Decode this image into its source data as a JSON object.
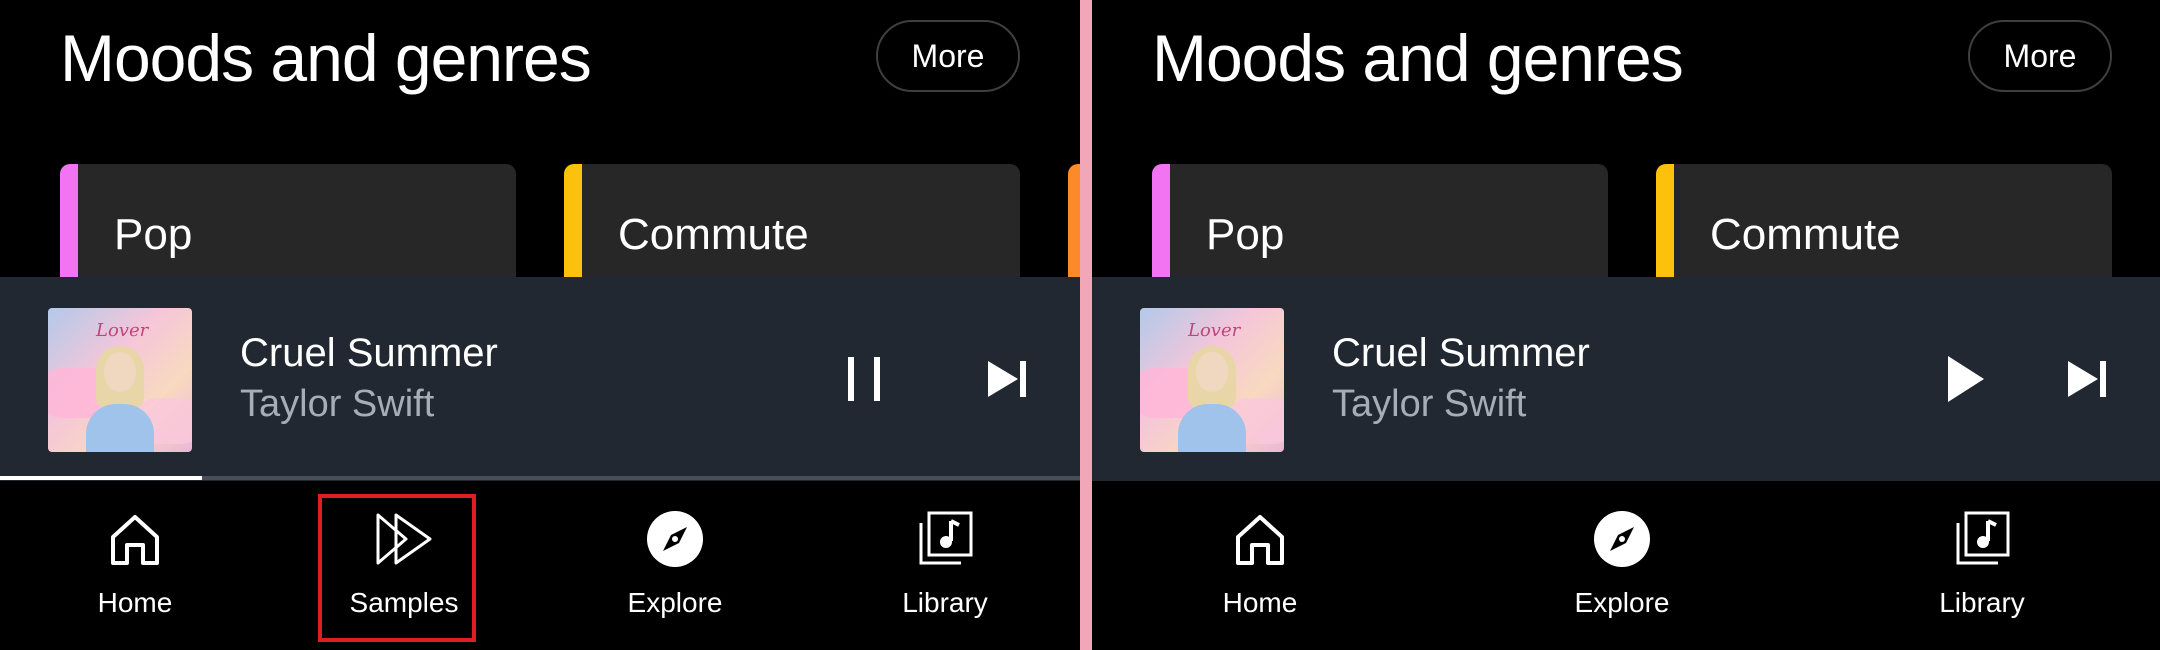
{
  "left_panel": {
    "section_title": "Moods and genres",
    "more_label": "More",
    "genres": [
      {
        "label": "Pop",
        "accent": "#f274f2"
      },
      {
        "label": "Commute",
        "accent": "#fbc10b"
      }
    ],
    "peek_accent": "#fc8a2a",
    "player": {
      "title": "Cruel Summer",
      "artist": "Taylor Swift",
      "album_script": "Lover",
      "state": "playing",
      "progress_fraction": 0.187
    },
    "nav": [
      {
        "label": "Home",
        "icon": "home-icon"
      },
      {
        "label": "Samples",
        "icon": "samples-icon"
      },
      {
        "label": "Explore",
        "icon": "compass-icon"
      },
      {
        "label": "Library",
        "icon": "library-icon"
      }
    ]
  },
  "right_panel": {
    "section_title": "Moods and genres",
    "more_label": "More",
    "genres": [
      {
        "label": "Pop",
        "accent": "#f274f2"
      },
      {
        "label": "Commute",
        "accent": "#fbc10b"
      }
    ],
    "player": {
      "title": "Cruel Summer",
      "artist": "Taylor Swift",
      "album_script": "Lover",
      "state": "paused"
    },
    "nav": [
      {
        "label": "Home",
        "icon": "home-icon"
      },
      {
        "label": "Explore",
        "icon": "compass-icon"
      },
      {
        "label": "Library",
        "icon": "library-icon"
      }
    ]
  },
  "colors": {
    "divider": "#f2a7b9",
    "highlight_box": "#e11d24",
    "player_bg": "#212832",
    "card_bg": "#272727",
    "artist_text": "#a7adb5"
  }
}
